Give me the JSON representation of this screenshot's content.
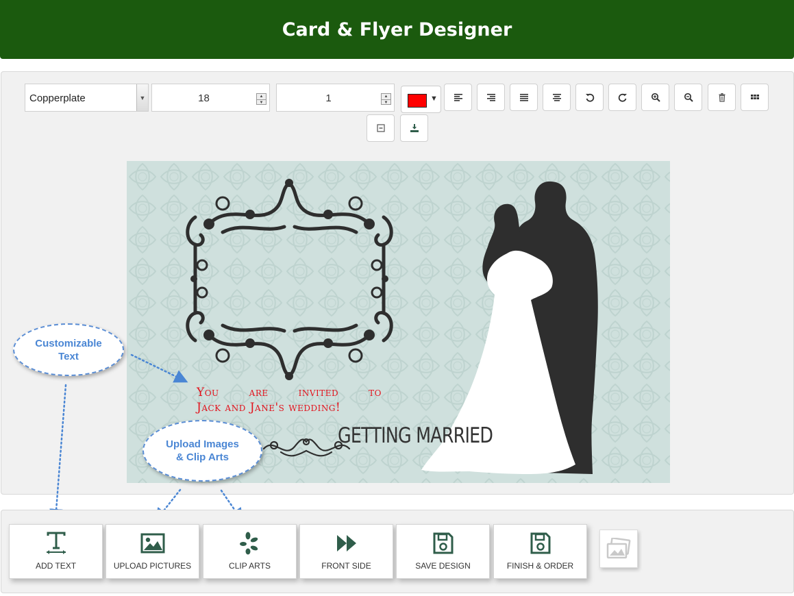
{
  "header": {
    "title": "Card & Flyer Designer"
  },
  "toolbar": {
    "font_family": "Copperplate",
    "font_size": "18",
    "line_spacing": "1",
    "color": "#ff0000",
    "icons": [
      "align-left-icon",
      "align-right-icon",
      "align-justify-icon",
      "align-center-icon",
      "undo-icon",
      "redo-icon",
      "zoom-in-icon",
      "zoom-out-icon",
      "trash-icon",
      "grid-icon",
      "minus-icon",
      "download-icon"
    ]
  },
  "canvas": {
    "headline": "GETTING MARRIED",
    "invite_line1_words": [
      "You",
      "are",
      "invited",
      "to"
    ],
    "invite_line2": "Jack and Jane's wedding!",
    "background_color": "#cfe0dd",
    "text_color": "#e2121c"
  },
  "callouts": {
    "text_line1": "Customizable",
    "text_line2": "Text",
    "images_line1": "Upload Images",
    "images_line2": "& Clip Arts"
  },
  "bottom_bar": {
    "add_text": "ADD TEXT",
    "upload_pictures": "UPLOAD PICTURES",
    "clip_arts": "CLIP ARTS",
    "front_side": "FRONT SIDE",
    "save_design": "SAVE DESIGN",
    "finish_order": "FINISH & ORDER"
  },
  "colors": {
    "header": "#1b5a0e",
    "icon": "#2f5d4a",
    "callout": "#4a86d4"
  }
}
